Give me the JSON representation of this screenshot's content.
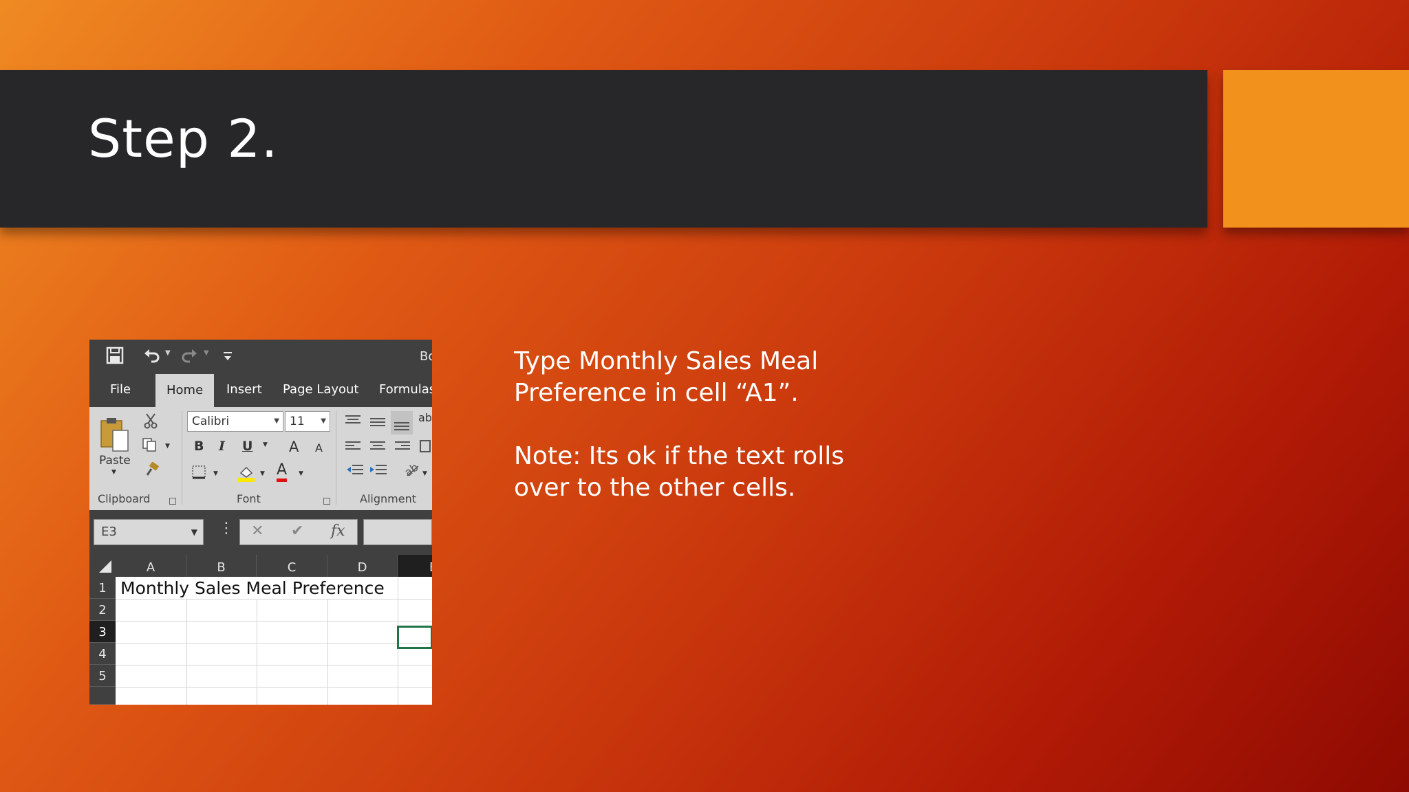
{
  "slide": {
    "title": "Step 2.",
    "instruction": "Type Monthly Sales Meal Preference in cell “A1”.",
    "note": "Note: Its ok if the text rolls over to the other cells.",
    "colors": {
      "title_bar": "#27272a",
      "accent": "#f2921d",
      "excel_selection": "#217346"
    }
  },
  "excel": {
    "quick_access": {
      "icons": [
        "save-icon",
        "undo-icon",
        "redo-icon",
        "customize-qat-icon"
      ],
      "book_title_fragment": "Bo"
    },
    "tabs": [
      {
        "label": "File"
      },
      {
        "label": "Home",
        "active": true
      },
      {
        "label": "Insert"
      },
      {
        "label": "Page Layout"
      },
      {
        "label": "Formulas"
      }
    ],
    "ribbon": {
      "clipboard": {
        "paste_label": "Paste",
        "group_label": "Clipboard"
      },
      "font": {
        "family": "Calibri",
        "size": "11",
        "bold": "B",
        "italic": "I",
        "underline": "U",
        "grow": "A",
        "shrink": "A",
        "font_color": "A",
        "group_label": "Font"
      },
      "alignment": {
        "group_label": "Alignment",
        "wrap_fragment": "ab"
      }
    },
    "formula_bar": {
      "name_box": "E3",
      "cancel": "✕",
      "enter": "✔",
      "fx": "fx",
      "value": ""
    },
    "grid": {
      "columns": [
        "A",
        "B",
        "C",
        "D",
        "E"
      ],
      "rows": [
        "1",
        "2",
        "3",
        "4",
        "5"
      ],
      "selected_cell": "E3",
      "a1_value": "Monthly Sales Meal Preference"
    }
  }
}
